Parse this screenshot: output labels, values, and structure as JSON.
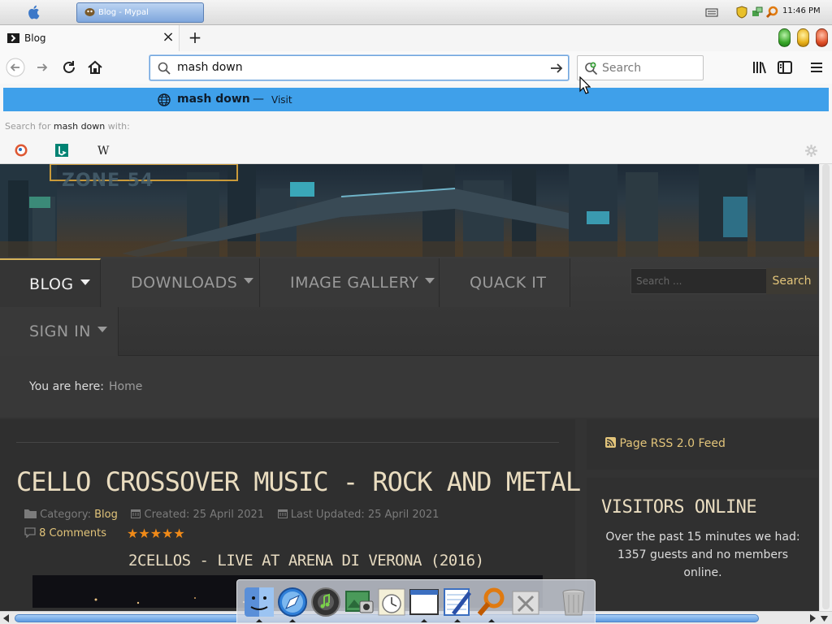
{
  "os": {
    "task_title": "Blog - Mypal",
    "clock": "11:46 PM"
  },
  "browser": {
    "tab_title": "Blog",
    "tab_close": "×",
    "new_tab": "+",
    "url_value": "mash down",
    "search_placeholder": "Search",
    "suggestion_text": "mash down",
    "suggestion_dash": "—",
    "suggestion_action": "Visit",
    "search_for_prefix": "Search for",
    "search_for_term": "mash down",
    "search_for_suffix": "with:",
    "wiki_glyph": "W"
  },
  "site": {
    "banner_logo": "ZONE 54",
    "menu": {
      "blog": "BLOG",
      "downloads": "DOWNLOADS",
      "gallery": "IMAGE GALLERY",
      "quack": "QUACK IT",
      "signin": "SIGN IN"
    },
    "search_placeholder": "Search ...",
    "search_button": "Search",
    "breadcrumb_label": "You are here:",
    "breadcrumb_home": "Home",
    "article": {
      "title": "CELLO CROSSOVER MUSIC - ROCK AND METAL",
      "category_label": "Category:",
      "category": "Blog",
      "created": "Created: 25 April 2021",
      "updated": "Last Updated: 25 April 2021",
      "comments": "8 Comments",
      "stars": "★★★★★",
      "subtitle": "2CELLOS - LIVE AT ARENA DI VERONA (2016)"
    },
    "rss": "Page RSS 2.0 Feed",
    "visitors_title": "VISITORS ONLINE",
    "visitors_text": "Over the past 15 minutes we had: 1357 guests and no members online."
  },
  "colors": {
    "accent": "#e2c47a",
    "highlight": "#3fa0ea",
    "stars": "#f08a18"
  }
}
